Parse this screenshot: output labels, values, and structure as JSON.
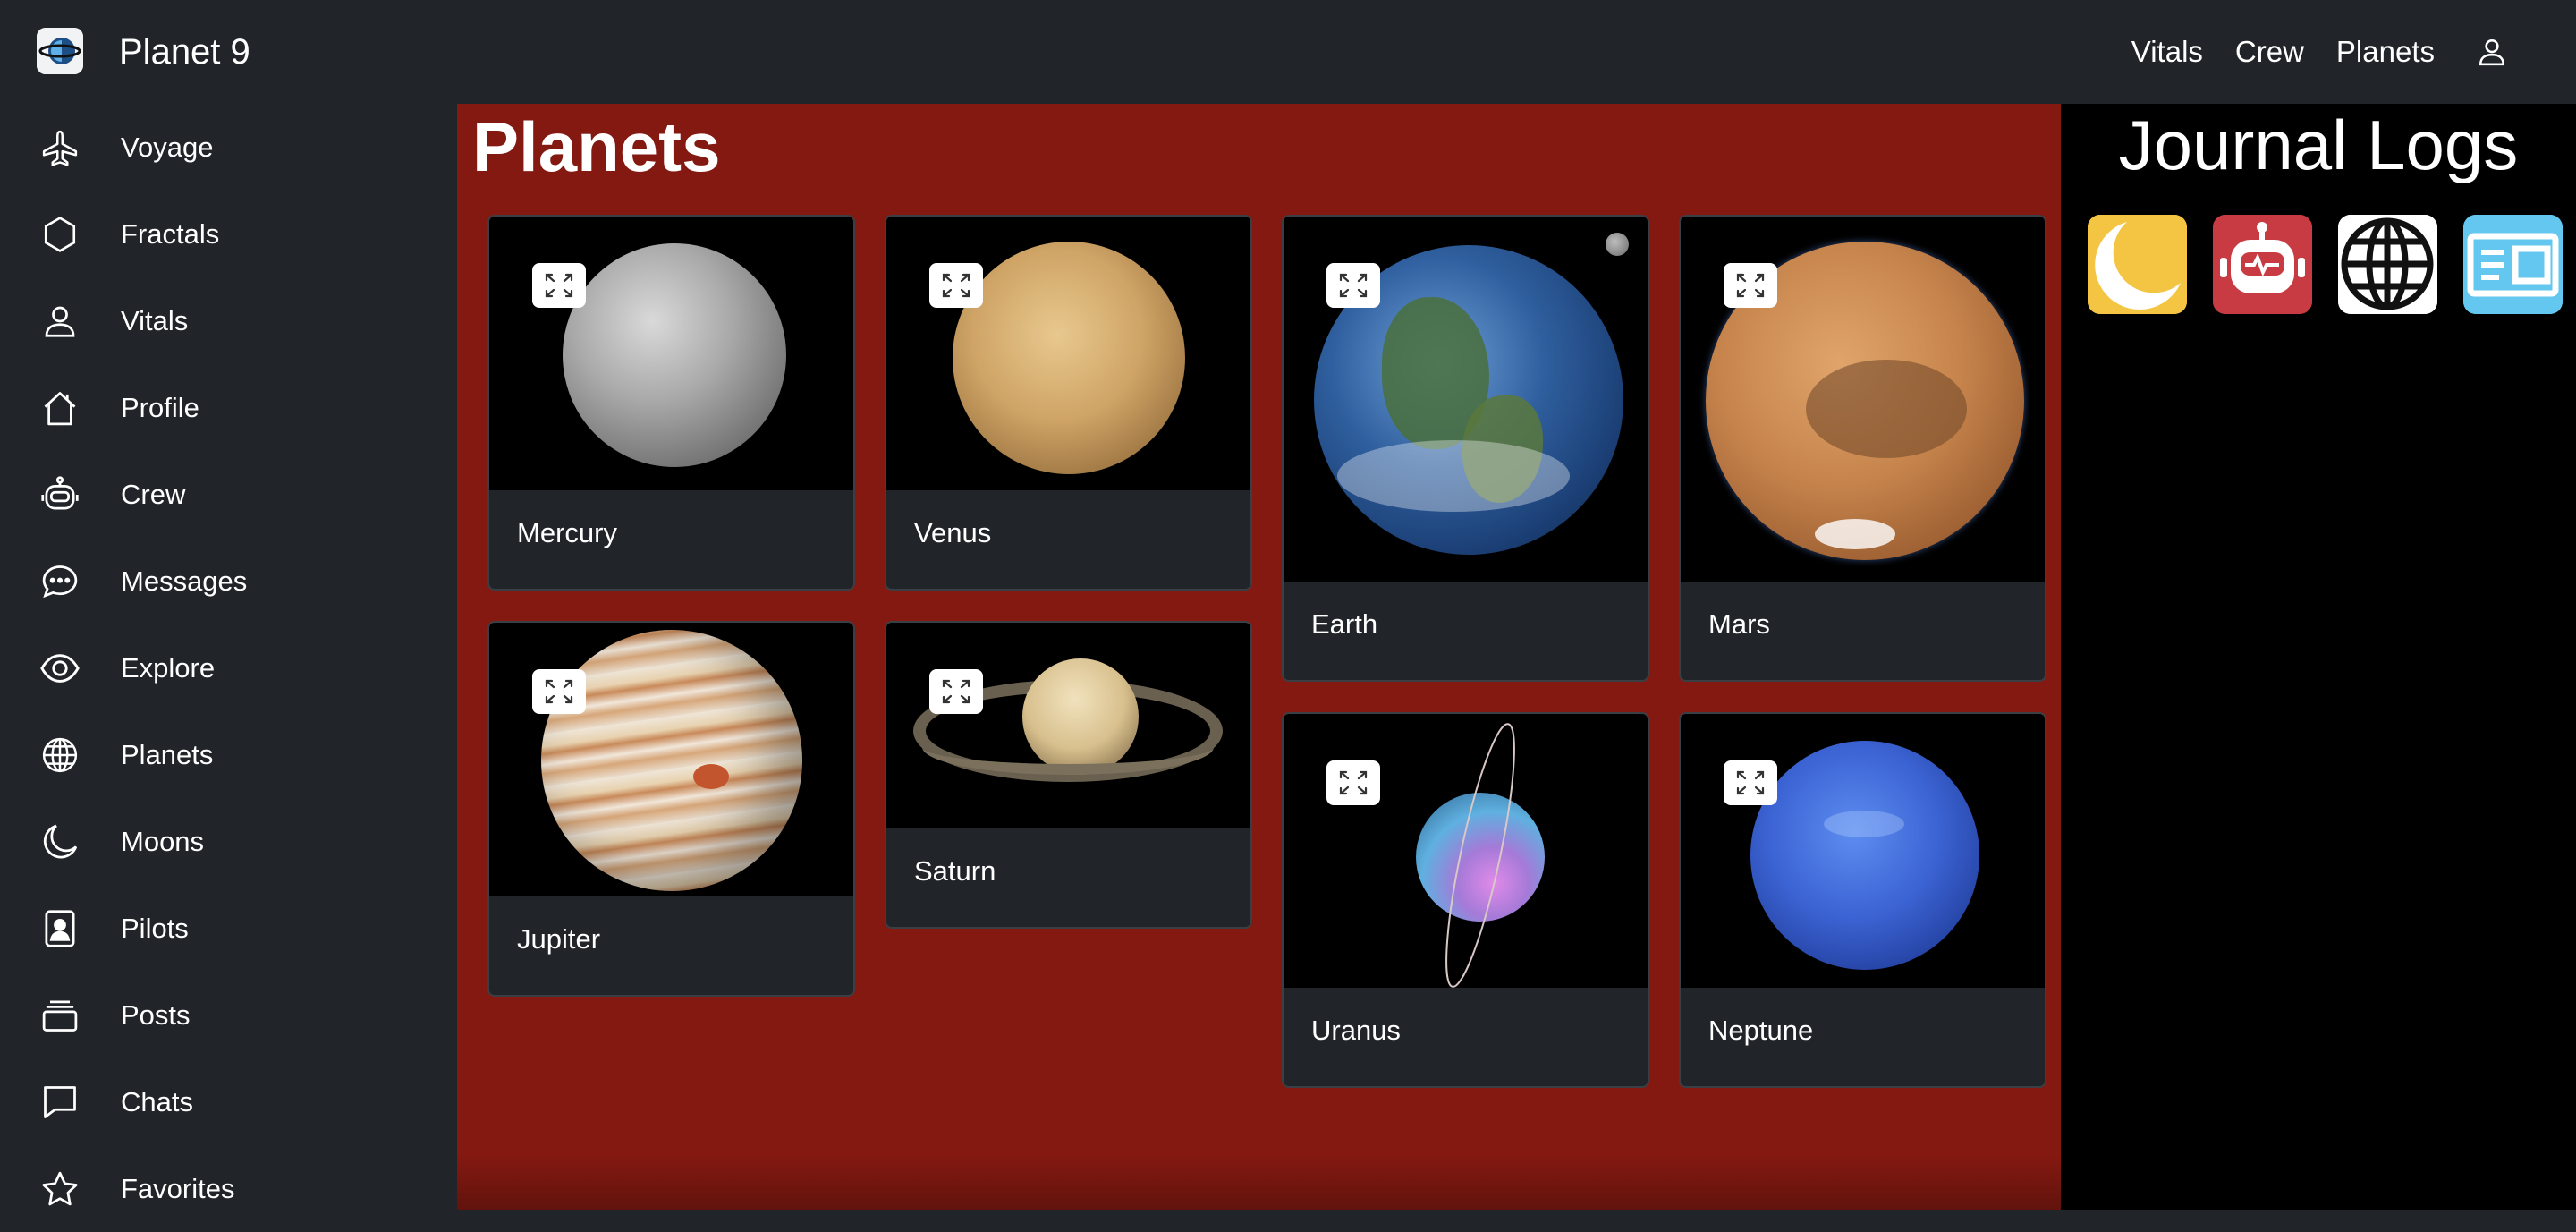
{
  "brand": {
    "title": "Planet 9",
    "logo_icon": "planet-logo-icon"
  },
  "topnav": {
    "links": [
      "Vitals",
      "Crew",
      "Planets"
    ],
    "user_icon": "user-icon"
  },
  "sidebar": {
    "items": [
      {
        "label": "Voyage",
        "icon": "airplane-icon"
      },
      {
        "label": "Fractals",
        "icon": "hexagon-icon"
      },
      {
        "label": "Vitals",
        "icon": "person-icon"
      },
      {
        "label": "Profile",
        "icon": "house-icon"
      },
      {
        "label": "Crew",
        "icon": "robot-icon"
      },
      {
        "label": "Messages",
        "icon": "chat-dots-icon"
      },
      {
        "label": "Explore",
        "icon": "eye-icon"
      },
      {
        "label": "Planets",
        "icon": "globe-icon"
      },
      {
        "label": "Moons",
        "icon": "moon-icon"
      },
      {
        "label": "Pilots",
        "icon": "badge-icon"
      },
      {
        "label": "Posts",
        "icon": "collection-icon"
      },
      {
        "label": "Chats",
        "icon": "chat-square-icon"
      },
      {
        "label": "Favorites",
        "icon": "star-icon"
      }
    ]
  },
  "main": {
    "title": "Planets",
    "planets": [
      {
        "name": "Mercury"
      },
      {
        "name": "Venus"
      },
      {
        "name": "Earth"
      },
      {
        "name": "Mars"
      },
      {
        "name": "Jupiter"
      },
      {
        "name": "Saturn"
      },
      {
        "name": "Uranus"
      },
      {
        "name": "Neptune"
      }
    ]
  },
  "journal": {
    "title": "Journal Logs",
    "apps": [
      "moon-app-icon",
      "robot-app-icon",
      "globe-app-icon",
      "news-app-icon"
    ]
  },
  "colors": {
    "background": "#212529",
    "main_panel": "#831911",
    "journal_panel": "#000000",
    "card": "#212529"
  }
}
